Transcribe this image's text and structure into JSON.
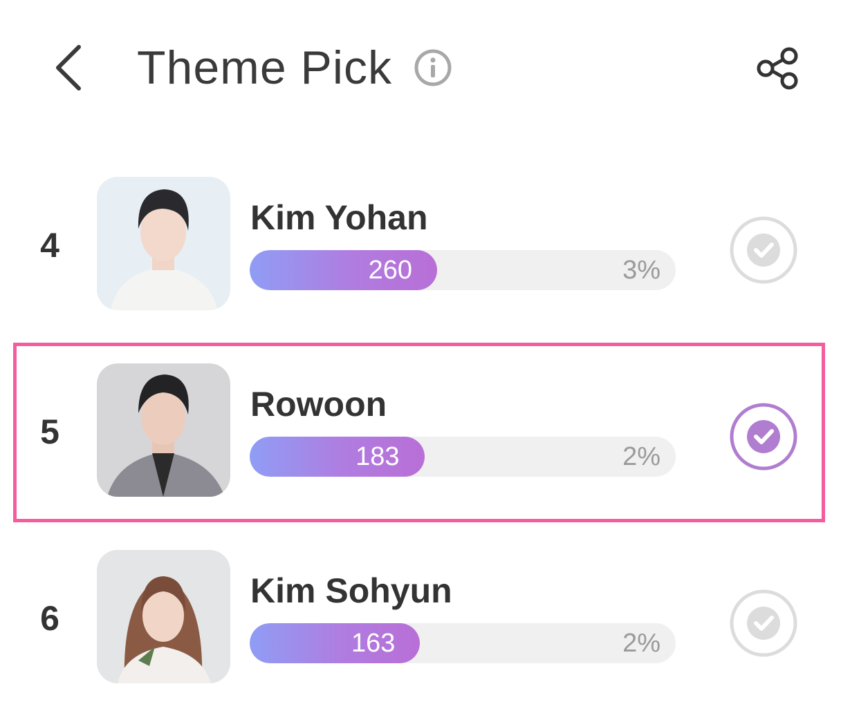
{
  "header": {
    "title": "Theme Pick",
    "back_icon": "chevron-left-icon",
    "info_icon": "info-icon",
    "share_icon": "share-icon"
  },
  "entries": [
    {
      "rank": "4",
      "name": "Kim Yohan",
      "votes": "260",
      "percent": "3%",
      "bar_fill_fraction": 0.44,
      "selected": false
    },
    {
      "rank": "5",
      "name": "Rowoon",
      "votes": "183",
      "percent": "2%",
      "bar_fill_fraction": 0.41,
      "selected": true
    },
    {
      "rank": "6",
      "name": "Kim Sohyun",
      "votes": "163",
      "percent": "2%",
      "bar_fill_fraction": 0.4,
      "selected": false
    }
  ],
  "colors": {
    "highlight_border": "#f35d9e",
    "bar_gradient_start": "#8f9df5",
    "bar_gradient_end": "#b86fd6",
    "vote_selected": "#b07dd0",
    "vote_unselected": "#dcdcdc"
  }
}
